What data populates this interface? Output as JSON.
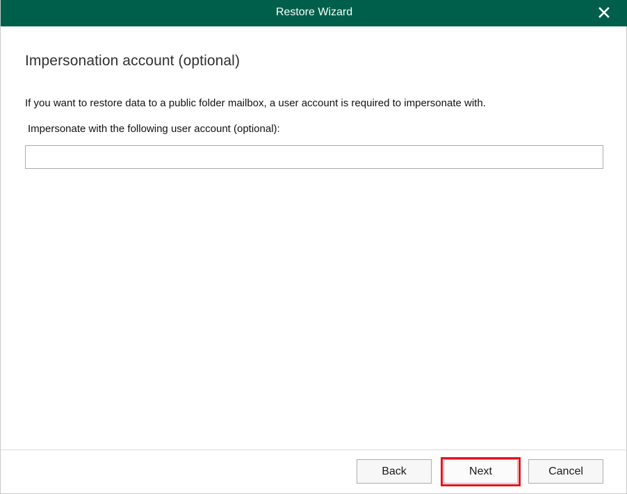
{
  "window": {
    "title": "Restore Wizard"
  },
  "page": {
    "heading": "Impersonation account (optional)",
    "description": "If you want to restore data to a public folder mailbox, a user account is required to impersonate with.",
    "field_label": "Impersonate with the following user account (optional):",
    "field_value": ""
  },
  "footer": {
    "back_label": "Back",
    "next_label": "Next",
    "cancel_label": "Cancel"
  },
  "colors": {
    "titlebar": "#005f4b",
    "highlight": "#e0141e"
  },
  "icons": {
    "close": "close-icon"
  }
}
